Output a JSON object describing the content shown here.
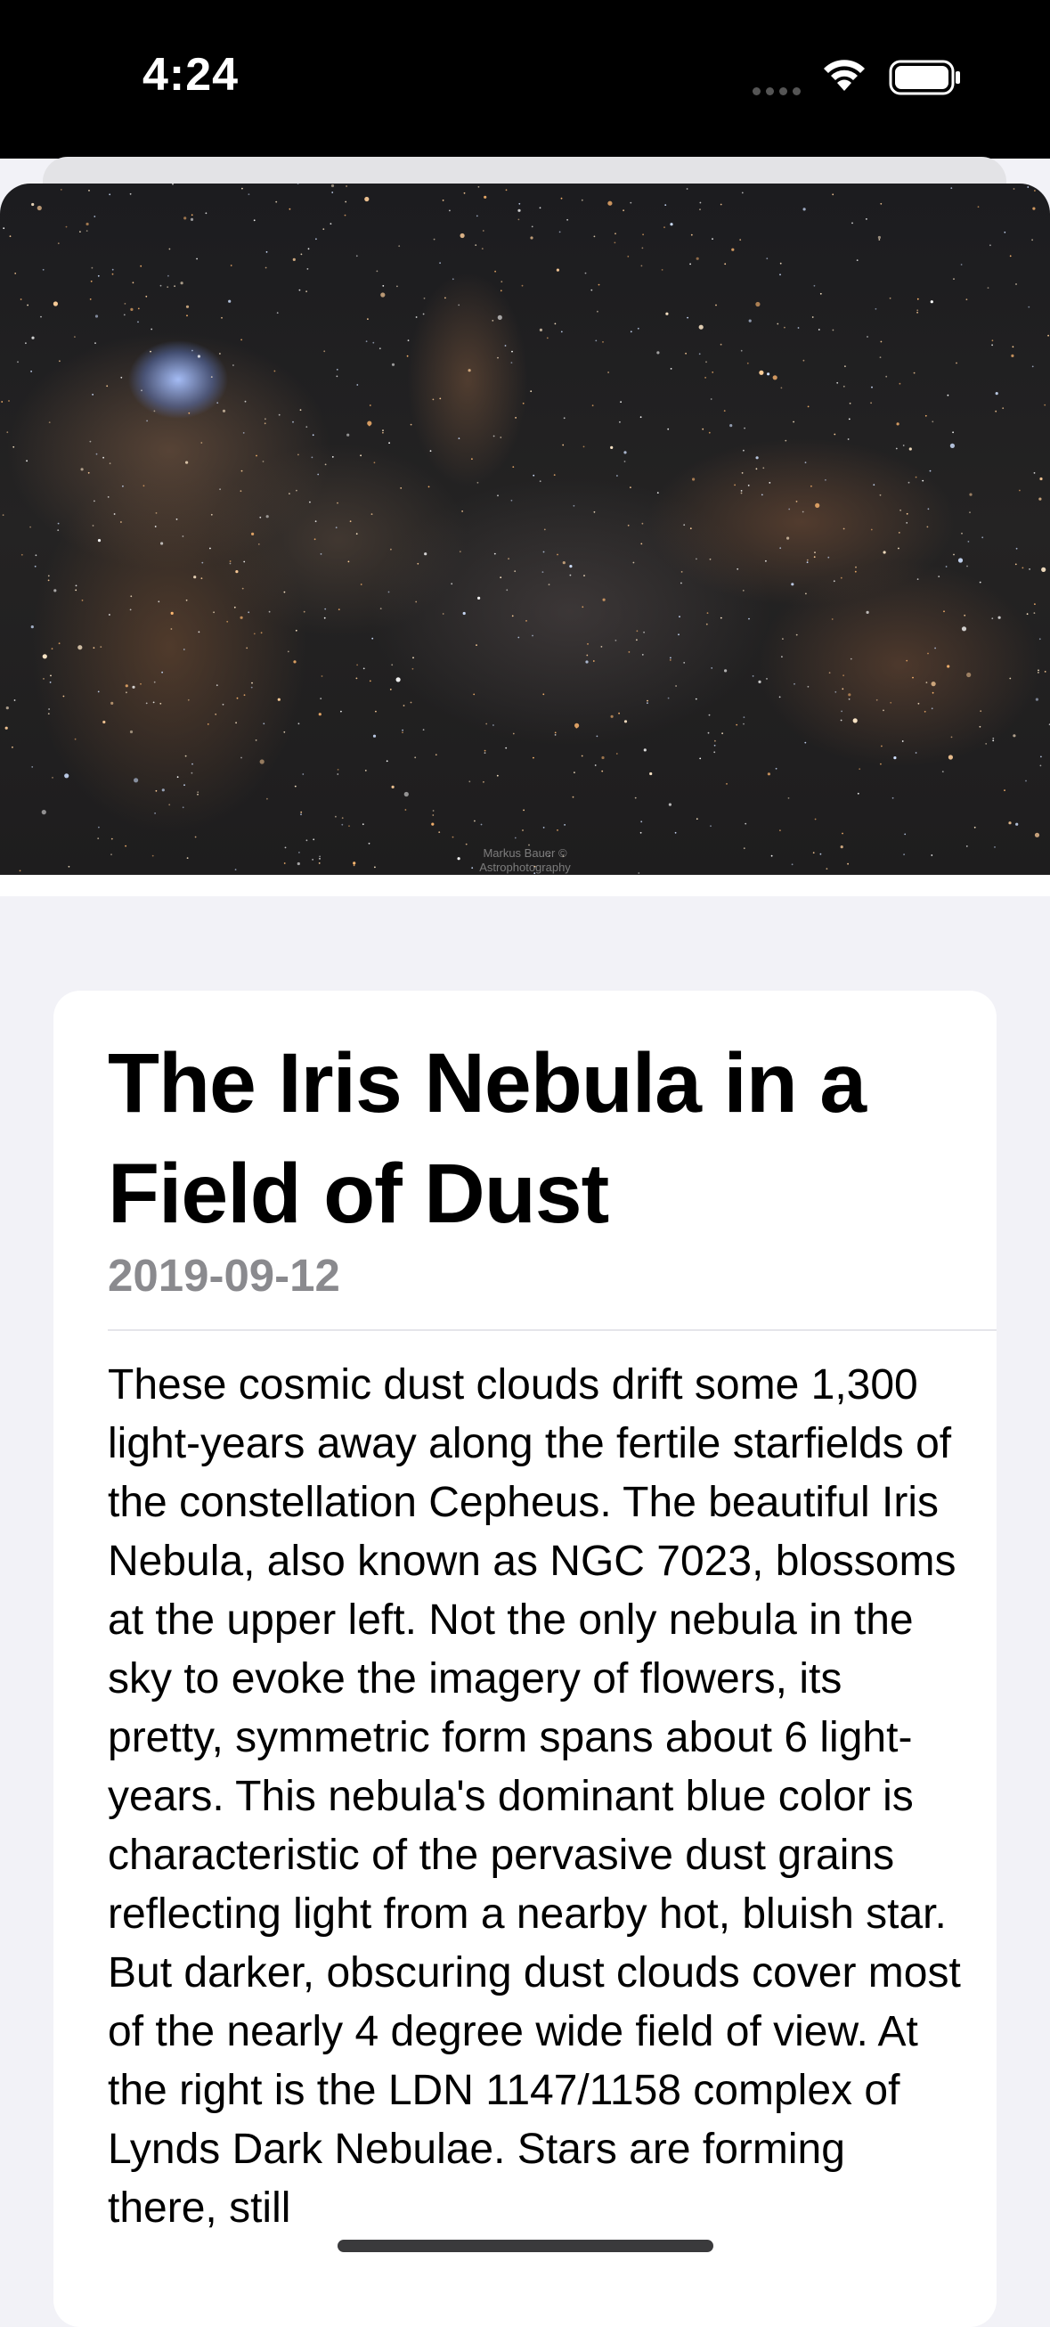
{
  "status_bar": {
    "time": "4:24",
    "icons": [
      "cellular-signal-icon",
      "wifi-icon",
      "battery-icon"
    ]
  },
  "hero_image": {
    "description_icon": "nebula-photo",
    "credit_line1": "Markus Bauer ©",
    "credit_line2": "Astrophotography"
  },
  "article": {
    "title": "The Iris Nebula in a Field of Dust",
    "date": "2019-09-12",
    "explanation": "These cosmic dust clouds drift some 1,300 light-years away along the fertile starfields of the constellation Cepheus. The beautiful Iris Nebula, also known as NGC 7023, blossoms at the upper left. Not the only nebula in the sky to evoke the imagery of flowers, its pretty, symmetric form spans about 6 light-years. This nebula's dominant blue color is characteristic of the pervasive dust grains reflecting light from a nearby hot, bluish star. But darker, obscuring dust clouds cover most of the nearly 4 degree wide field of view. At the right is the LDN 1147/1158 complex of Lynds Dark Nebulae. Stars are forming there, still"
  },
  "colors": {
    "background": "#f2f2f7",
    "card": "#ffffff",
    "date_text": "#8a8a8e",
    "status_bar": "#000000"
  }
}
